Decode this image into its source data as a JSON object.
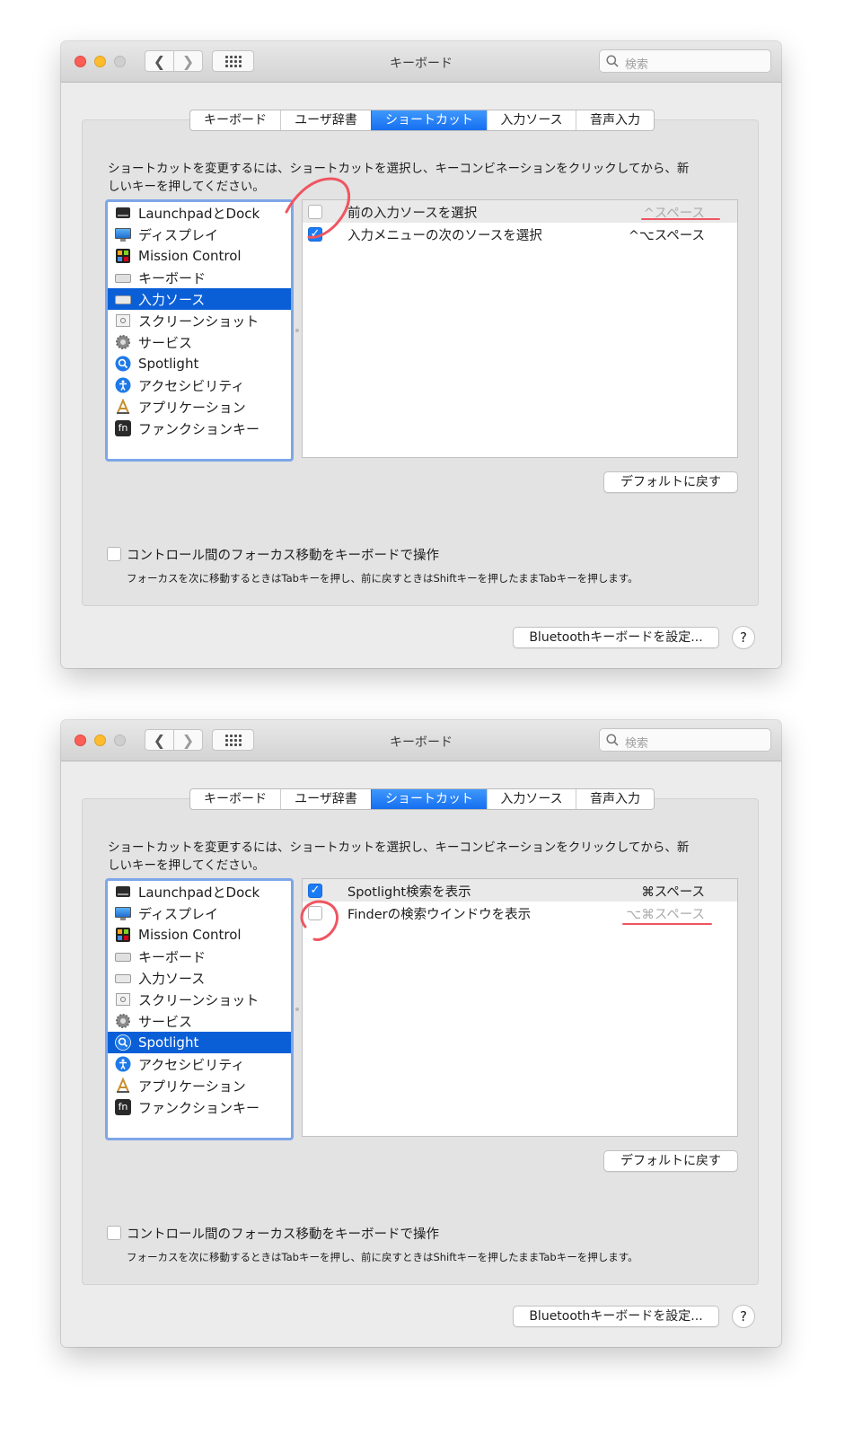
{
  "accent_color": "#0a5fd7",
  "annotation_color": "#ef5561",
  "windows": [
    {
      "title": "キーボード",
      "search_placeholder": "検索",
      "tabs": [
        {
          "label": "キーボード",
          "active": false
        },
        {
          "label": "ユーザ辞書",
          "active": false
        },
        {
          "label": "ショートカット",
          "active": true
        },
        {
          "label": "入力ソース",
          "active": false
        },
        {
          "label": "音声入力",
          "active": false
        }
      ],
      "instruction_line1": "ショートカットを変更するには、ショートカットを選択し、キーコンビネーションをクリックしてから、新",
      "instruction_line2": "しいキーを押してください。",
      "categories": [
        {
          "label": "LaunchpadとDock",
          "icon": "launchpad-dock-icon",
          "selected": false
        },
        {
          "label": "ディスプレイ",
          "icon": "display-icon",
          "selected": false
        },
        {
          "label": "Mission Control",
          "icon": "mission-control-icon",
          "selected": false
        },
        {
          "label": "キーボード",
          "icon": "keyboard-icon",
          "selected": false
        },
        {
          "label": "入力ソース",
          "icon": "input-source-icon",
          "selected": true
        },
        {
          "label": "スクリーンショット",
          "icon": "screenshot-icon",
          "selected": false
        },
        {
          "label": "サービス",
          "icon": "services-gear-icon",
          "selected": false
        },
        {
          "label": "Spotlight",
          "icon": "spotlight-icon",
          "selected": false
        },
        {
          "label": "アクセシビリティ",
          "icon": "accessibility-icon",
          "selected": false
        },
        {
          "label": "アプリケーション",
          "icon": "applications-icon",
          "selected": false
        },
        {
          "label": "ファンクションキー",
          "icon": "fn-key-icon",
          "selected": false
        }
      ],
      "shortcuts": [
        {
          "label": "前の入力ソースを選択",
          "key": "^スペース",
          "checked": false,
          "dim": true
        },
        {
          "label": "入力メニューの次のソースを選択",
          "key": "^⌥スペース",
          "checked": true,
          "dim": false
        }
      ],
      "restore_defaults_label": "デフォルトに戻す",
      "focus_label": "コントロール間のフォーカス移動をキーボードで操作",
      "focus_help": "フォーカスを次に移動するときはTabキーを押し、前に戻すときはShiftキーを押したままTabキーを押します。",
      "bluetooth_label": "Bluetoothキーボードを設定...",
      "help_label": "?"
    },
    {
      "title": "キーボード",
      "search_placeholder": "検索",
      "tabs": [
        {
          "label": "キーボード",
          "active": false
        },
        {
          "label": "ユーザ辞書",
          "active": false
        },
        {
          "label": "ショートカット",
          "active": true
        },
        {
          "label": "入力ソース",
          "active": false
        },
        {
          "label": "音声入力",
          "active": false
        }
      ],
      "instruction_line1": "ショートカットを変更するには、ショートカットを選択し、キーコンビネーションをクリックしてから、新",
      "instruction_line2": "しいキーを押してください。",
      "categories": [
        {
          "label": "LaunchpadとDock",
          "icon": "launchpad-dock-icon",
          "selected": false
        },
        {
          "label": "ディスプレイ",
          "icon": "display-icon",
          "selected": false
        },
        {
          "label": "Mission Control",
          "icon": "mission-control-icon",
          "selected": false
        },
        {
          "label": "キーボード",
          "icon": "keyboard-icon",
          "selected": false
        },
        {
          "label": "入力ソース",
          "icon": "input-source-icon",
          "selected": false
        },
        {
          "label": "スクリーンショット",
          "icon": "screenshot-icon",
          "selected": false
        },
        {
          "label": "サービス",
          "icon": "services-gear-icon",
          "selected": false
        },
        {
          "label": "Spotlight",
          "icon": "spotlight-icon",
          "selected": true
        },
        {
          "label": "アクセシビリティ",
          "icon": "accessibility-icon",
          "selected": false
        },
        {
          "label": "アプリケーション",
          "icon": "applications-icon",
          "selected": false
        },
        {
          "label": "ファンクションキー",
          "icon": "fn-key-icon",
          "selected": false
        }
      ],
      "shortcuts": [
        {
          "label": "Spotlight検索を表示",
          "key": "⌘スペース",
          "checked": true,
          "dim": false
        },
        {
          "label": "Finderの検索ウインドウを表示",
          "key": "⌥⌘スペース",
          "checked": false,
          "dim": true
        }
      ],
      "restore_defaults_label": "デフォルトに戻す",
      "focus_label": "コントロール間のフォーカス移動をキーボードで操作",
      "focus_help": "フォーカスを次に移動するときはTabキーを押し、前に戻すときはShiftキーを押したままTabキーを押します。",
      "bluetooth_label": "Bluetoothキーボードを設定...",
      "help_label": "?"
    }
  ]
}
